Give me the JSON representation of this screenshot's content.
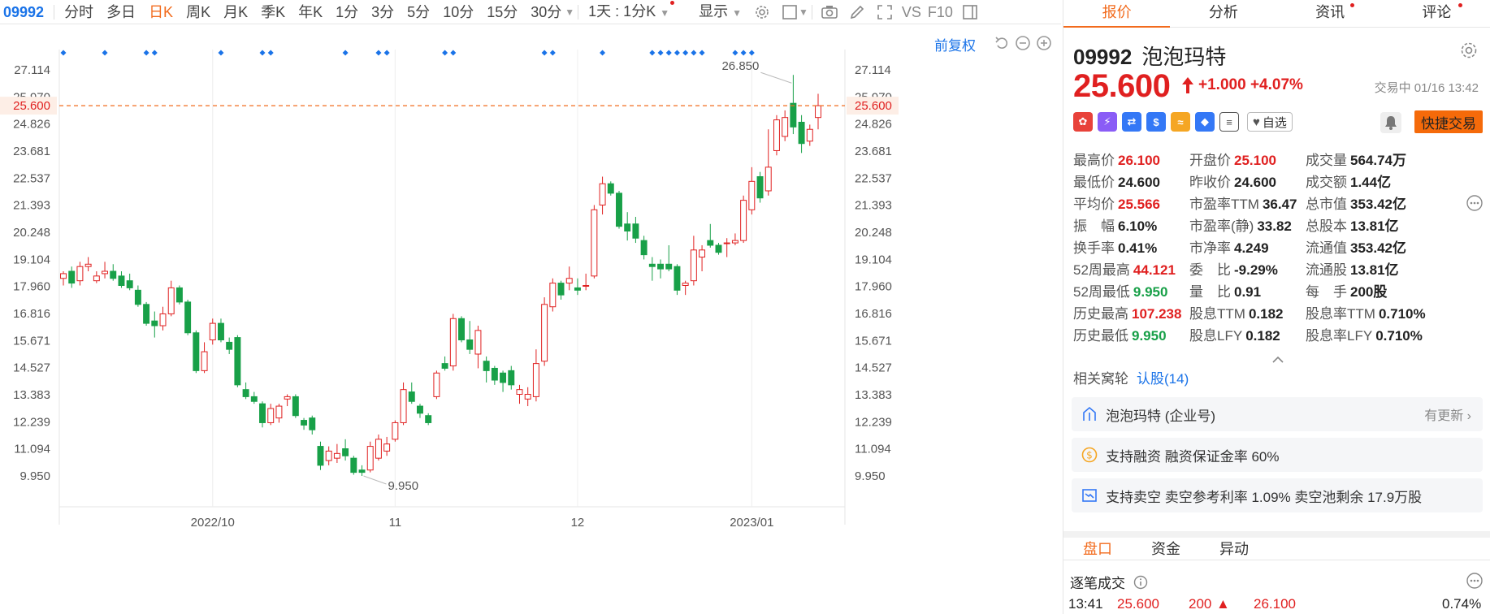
{
  "toolbar": {
    "symbol": "09992",
    "periods": [
      "分时",
      "多日",
      "日K",
      "周K",
      "月K",
      "季K",
      "年K",
      "1分",
      "3分",
      "5分",
      "10分",
      "15分",
      "30分"
    ],
    "active_period": "日K",
    "interval": "1天 : 1分K",
    "display": "显示",
    "vs": "VS",
    "f10": "F10"
  },
  "chart": {
    "adjust_label": "前复权",
    "current_price_label": "25.600",
    "high_marker": "26.850",
    "low_marker": "9.950",
    "colors": {
      "up": "#e02020",
      "down": "#18a048",
      "price_line": "#f26b1d",
      "marker": "#1a73e8"
    }
  },
  "chart_data": {
    "type": "candlestick",
    "y_axis_ticks": [
      27.114,
      25.97,
      24.826,
      23.681,
      22.537,
      21.393,
      20.248,
      19.104,
      17.96,
      16.816,
      15.671,
      14.527,
      13.383,
      12.239,
      11.094,
      9.95
    ],
    "ylim": [
      9.95,
      27.114
    ],
    "x_axis_labels": [
      "2022/10",
      "11",
      "12",
      "2023/01"
    ],
    "current_price": 25.6,
    "annotated_high": 26.85,
    "annotated_low": 9.95,
    "candles": [
      {
        "o": 18.3,
        "h": 18.6,
        "l": 18.0,
        "c": 18.5
      },
      {
        "o": 18.6,
        "h": 18.8,
        "l": 17.9,
        "c": 18.1
      },
      {
        "o": 18.2,
        "h": 19.0,
        "l": 18.0,
        "c": 18.8
      },
      {
        "o": 18.8,
        "h": 19.2,
        "l": 18.6,
        "c": 18.9
      },
      {
        "o": 18.2,
        "h": 18.6,
        "l": 18.1,
        "c": 18.4
      },
      {
        "o": 18.5,
        "h": 19.0,
        "l": 18.3,
        "c": 18.6
      },
      {
        "o": 18.6,
        "h": 18.9,
        "l": 18.2,
        "c": 18.3
      },
      {
        "o": 18.4,
        "h": 18.6,
        "l": 17.9,
        "c": 18.0
      },
      {
        "o": 18.2,
        "h": 18.5,
        "l": 17.8,
        "c": 17.9
      },
      {
        "o": 17.8,
        "h": 18.0,
        "l": 17.1,
        "c": 17.2
      },
      {
        "o": 17.2,
        "h": 17.3,
        "l": 16.3,
        "c": 16.4
      },
      {
        "o": 16.5,
        "h": 16.9,
        "l": 15.8,
        "c": 16.3
      },
      {
        "o": 16.3,
        "h": 17.1,
        "l": 16.1,
        "c": 16.8
      },
      {
        "o": 16.8,
        "h": 18.2,
        "l": 16.7,
        "c": 17.9
      },
      {
        "o": 17.9,
        "h": 18.0,
        "l": 17.2,
        "c": 17.3
      },
      {
        "o": 17.3,
        "h": 17.4,
        "l": 15.9,
        "c": 16.0
      },
      {
        "o": 16.0,
        "h": 16.1,
        "l": 14.3,
        "c": 14.4
      },
      {
        "o": 14.4,
        "h": 15.6,
        "l": 14.3,
        "c": 15.2
      },
      {
        "o": 15.7,
        "h": 16.6,
        "l": 15.5,
        "c": 16.4
      },
      {
        "o": 16.4,
        "h": 16.6,
        "l": 15.6,
        "c": 15.7
      },
      {
        "o": 15.6,
        "h": 15.8,
        "l": 15.1,
        "c": 15.3
      },
      {
        "o": 15.8,
        "h": 15.9,
        "l": 13.7,
        "c": 13.8
      },
      {
        "o": 13.6,
        "h": 13.9,
        "l": 13.2,
        "c": 13.3
      },
      {
        "o": 13.3,
        "h": 13.5,
        "l": 13.0,
        "c": 13.1
      },
      {
        "o": 13.0,
        "h": 13.1,
        "l": 12.0,
        "c": 12.2
      },
      {
        "o": 12.2,
        "h": 13.0,
        "l": 12.1,
        "c": 12.8
      },
      {
        "o": 12.4,
        "h": 13.0,
        "l": 12.2,
        "c": 12.9
      },
      {
        "o": 13.2,
        "h": 13.4,
        "l": 12.9,
        "c": 13.3
      },
      {
        "o": 13.3,
        "h": 13.4,
        "l": 12.4,
        "c": 12.5
      },
      {
        "o": 12.3,
        "h": 12.4,
        "l": 11.9,
        "c": 12.1
      },
      {
        "o": 12.4,
        "h": 12.5,
        "l": 11.7,
        "c": 11.9
      },
      {
        "o": 11.2,
        "h": 11.4,
        "l": 10.2,
        "c": 10.4
      },
      {
        "o": 10.6,
        "h": 11.2,
        "l": 10.4,
        "c": 11.0
      },
      {
        "o": 10.7,
        "h": 11.3,
        "l": 10.5,
        "c": 10.9
      },
      {
        "o": 11.1,
        "h": 11.5,
        "l": 10.6,
        "c": 10.8
      },
      {
        "o": 10.7,
        "h": 10.8,
        "l": 10.0,
        "c": 10.1
      },
      {
        "o": 10.2,
        "h": 10.4,
        "l": 9.95,
        "c": 10.1
      },
      {
        "o": 10.2,
        "h": 11.4,
        "l": 10.1,
        "c": 11.2
      },
      {
        "o": 10.7,
        "h": 11.7,
        "l": 10.6,
        "c": 11.5
      },
      {
        "o": 11.0,
        "h": 11.6,
        "l": 10.8,
        "c": 11.3
      },
      {
        "o": 11.5,
        "h": 12.3,
        "l": 11.4,
        "c": 12.2
      },
      {
        "o": 12.2,
        "h": 13.9,
        "l": 12.1,
        "c": 13.6
      },
      {
        "o": 13.5,
        "h": 13.9,
        "l": 13.0,
        "c": 13.1
      },
      {
        "o": 12.9,
        "h": 13.0,
        "l": 12.4,
        "c": 12.6
      },
      {
        "o": 12.5,
        "h": 12.6,
        "l": 12.1,
        "c": 12.2
      },
      {
        "o": 13.3,
        "h": 14.4,
        "l": 13.2,
        "c": 14.3
      },
      {
        "o": 14.7,
        "h": 15.0,
        "l": 14.4,
        "c": 14.5
      },
      {
        "o": 14.6,
        "h": 16.8,
        "l": 14.4,
        "c": 16.6
      },
      {
        "o": 16.6,
        "h": 16.7,
        "l": 15.6,
        "c": 15.7
      },
      {
        "o": 15.7,
        "h": 16.5,
        "l": 15.1,
        "c": 15.3
      },
      {
        "o": 15.1,
        "h": 16.3,
        "l": 14.5,
        "c": 16.1
      },
      {
        "o": 14.8,
        "h": 15.0,
        "l": 13.9,
        "c": 14.4
      },
      {
        "o": 14.5,
        "h": 14.6,
        "l": 13.8,
        "c": 14.0
      },
      {
        "o": 14.3,
        "h": 14.4,
        "l": 13.5,
        "c": 13.9
      },
      {
        "o": 14.4,
        "h": 14.6,
        "l": 13.6,
        "c": 13.8
      },
      {
        "o": 13.4,
        "h": 13.8,
        "l": 13.0,
        "c": 13.6
      },
      {
        "o": 13.2,
        "h": 13.7,
        "l": 12.9,
        "c": 13.4
      },
      {
        "o": 13.3,
        "h": 15.3,
        "l": 13.1,
        "c": 14.7
      },
      {
        "o": 14.8,
        "h": 17.5,
        "l": 14.6,
        "c": 17.2
      },
      {
        "o": 17.1,
        "h": 18.3,
        "l": 16.9,
        "c": 18.1
      },
      {
        "o": 18.1,
        "h": 18.2,
        "l": 17.4,
        "c": 17.6
      },
      {
        "o": 18.1,
        "h": 18.8,
        "l": 17.8,
        "c": 18.3
      },
      {
        "o": 17.9,
        "h": 18.3,
        "l": 17.6,
        "c": 17.8
      },
      {
        "o": 18.0,
        "h": 18.5,
        "l": 17.8,
        "c": 18.0
      },
      {
        "o": 18.4,
        "h": 21.4,
        "l": 18.3,
        "c": 21.2
      },
      {
        "o": 21.4,
        "h": 22.6,
        "l": 21.0,
        "c": 22.3
      },
      {
        "o": 22.3,
        "h": 22.4,
        "l": 21.8,
        "c": 21.9
      },
      {
        "o": 21.9,
        "h": 22.0,
        "l": 20.4,
        "c": 20.5
      },
      {
        "o": 20.6,
        "h": 21.1,
        "l": 19.9,
        "c": 20.3
      },
      {
        "o": 20.6,
        "h": 20.9,
        "l": 19.8,
        "c": 20.0
      },
      {
        "o": 19.9,
        "h": 20.1,
        "l": 19.1,
        "c": 19.3
      },
      {
        "o": 18.9,
        "h": 19.2,
        "l": 18.2,
        "c": 18.8
      },
      {
        "o": 18.9,
        "h": 19.1,
        "l": 18.3,
        "c": 18.7
      },
      {
        "o": 18.9,
        "h": 19.7,
        "l": 18.6,
        "c": 18.7
      },
      {
        "o": 18.8,
        "h": 18.9,
        "l": 17.6,
        "c": 17.8
      },
      {
        "o": 18.0,
        "h": 18.2,
        "l": 17.6,
        "c": 18.1
      },
      {
        "o": 18.2,
        "h": 20.1,
        "l": 18.0,
        "c": 19.5
      },
      {
        "o": 19.2,
        "h": 19.7,
        "l": 18.6,
        "c": 19.5
      },
      {
        "o": 19.9,
        "h": 20.6,
        "l": 19.6,
        "c": 19.7
      },
      {
        "o": 19.7,
        "h": 19.8,
        "l": 19.3,
        "c": 19.4
      },
      {
        "o": 19.8,
        "h": 20.0,
        "l": 19.2,
        "c": 19.8
      },
      {
        "o": 19.8,
        "h": 20.2,
        "l": 19.7,
        "c": 19.9
      },
      {
        "o": 19.9,
        "h": 21.8,
        "l": 19.8,
        "c": 21.6
      },
      {
        "o": 21.2,
        "h": 23.0,
        "l": 21.0,
        "c": 22.4
      },
      {
        "o": 22.6,
        "h": 22.8,
        "l": 21.5,
        "c": 21.7
      },
      {
        "o": 22.0,
        "h": 24.6,
        "l": 21.8,
        "c": 23.0
      },
      {
        "o": 23.7,
        "h": 25.2,
        "l": 23.5,
        "c": 25.0
      },
      {
        "o": 24.3,
        "h": 25.4,
        "l": 24.1,
        "c": 25.1
      },
      {
        "o": 25.7,
        "h": 26.9,
        "l": 24.4,
        "c": 24.7
      },
      {
        "o": 24.9,
        "h": 25.2,
        "l": 23.6,
        "c": 24.0
      },
      {
        "o": 24.1,
        "h": 24.8,
        "l": 23.9,
        "c": 24.6
      },
      {
        "o": 25.1,
        "h": 26.1,
        "l": 24.6,
        "c": 25.6
      }
    ],
    "event_marker_indices": [
      0,
      5,
      10,
      11,
      19,
      24,
      25,
      34,
      38,
      39,
      46,
      47,
      58,
      59,
      65,
      71,
      72,
      73,
      74,
      75,
      76,
      77,
      81,
      82,
      83
    ]
  },
  "panel": {
    "tabs": [
      "报价",
      "分析",
      "资讯",
      "评论"
    ],
    "active_tab": "报价",
    "code": "09992",
    "name": "泡泡玛特",
    "price": "25.600",
    "change": "+1.000",
    "change_pct": "+4.07%",
    "status": "交易中 01/16 13:42",
    "watch_label": "自选",
    "quick_trade": "快捷交易",
    "stats": [
      [
        {
          "k": "最高价",
          "v": "26.100",
          "c": "red"
        },
        {
          "k": "开盘价",
          "v": "25.100",
          "c": "red"
        },
        {
          "k": "成交量",
          "v": "564.74万",
          "c": ""
        }
      ],
      [
        {
          "k": "最低价",
          "v": "24.600",
          "c": ""
        },
        {
          "k": "昨收价",
          "v": "24.600",
          "c": ""
        },
        {
          "k": "成交额",
          "v": "1.44亿",
          "c": ""
        }
      ],
      [
        {
          "k": "平均价",
          "v": "25.566",
          "c": "red"
        },
        {
          "k": "市盈率TTM",
          "v": "36.47",
          "c": ""
        },
        {
          "k": "总市值",
          "v": "353.42亿",
          "c": ""
        }
      ],
      [
        {
          "k": "振　幅",
          "v": "6.10%",
          "c": ""
        },
        {
          "k": "市盈率(静)",
          "v": "33.82",
          "c": ""
        },
        {
          "k": "总股本",
          "v": "13.81亿",
          "c": ""
        }
      ],
      [
        {
          "k": "换手率",
          "v": "0.41%",
          "c": ""
        },
        {
          "k": "市净率",
          "v": "4.249",
          "c": ""
        },
        {
          "k": "流通值",
          "v": "353.42亿",
          "c": ""
        }
      ],
      [
        {
          "k": "52周最高",
          "v": "44.121",
          "c": "red"
        },
        {
          "k": "委　比",
          "v": "-9.29%",
          "c": ""
        },
        {
          "k": "流通股",
          "v": "13.81亿",
          "c": ""
        }
      ],
      [
        {
          "k": "52周最低",
          "v": "9.950",
          "c": "green"
        },
        {
          "k": "量　比",
          "v": "0.91",
          "c": ""
        },
        {
          "k": "每　手",
          "v": "200股",
          "c": ""
        }
      ],
      [
        {
          "k": "历史最高",
          "v": "107.238",
          "c": "red"
        },
        {
          "k": "股息TTM",
          "v": "0.182",
          "c": ""
        },
        {
          "k": "股息率TTM",
          "v": "0.710%",
          "c": ""
        }
      ],
      [
        {
          "k": "历史最低",
          "v": "9.950",
          "c": "green"
        },
        {
          "k": "股息LFY",
          "v": "0.182",
          "c": ""
        },
        {
          "k": "股息率LFY",
          "v": "0.710%",
          "c": ""
        }
      ]
    ],
    "related_label": "相关窝轮",
    "related_link": "认股(14)",
    "cards": [
      {
        "text": "泡泡玛特 (企业号)",
        "right": "有更新"
      },
      {
        "text": "支持融资  融资保证金率 60%",
        "right": ""
      },
      {
        "text": "支持卖空  卖空参考利率 1.09%  卖空池剩余 17.9万股",
        "right": ""
      }
    ],
    "sub_tabs": [
      "盘口",
      "资金",
      "异动"
    ],
    "active_sub_tab": "盘口",
    "ticks_title": "逐笔成交",
    "tick_row": {
      "time": "13:41",
      "price": "25.600",
      "vol": "200",
      "ask": "26.100",
      "pct": "0.74%"
    }
  }
}
